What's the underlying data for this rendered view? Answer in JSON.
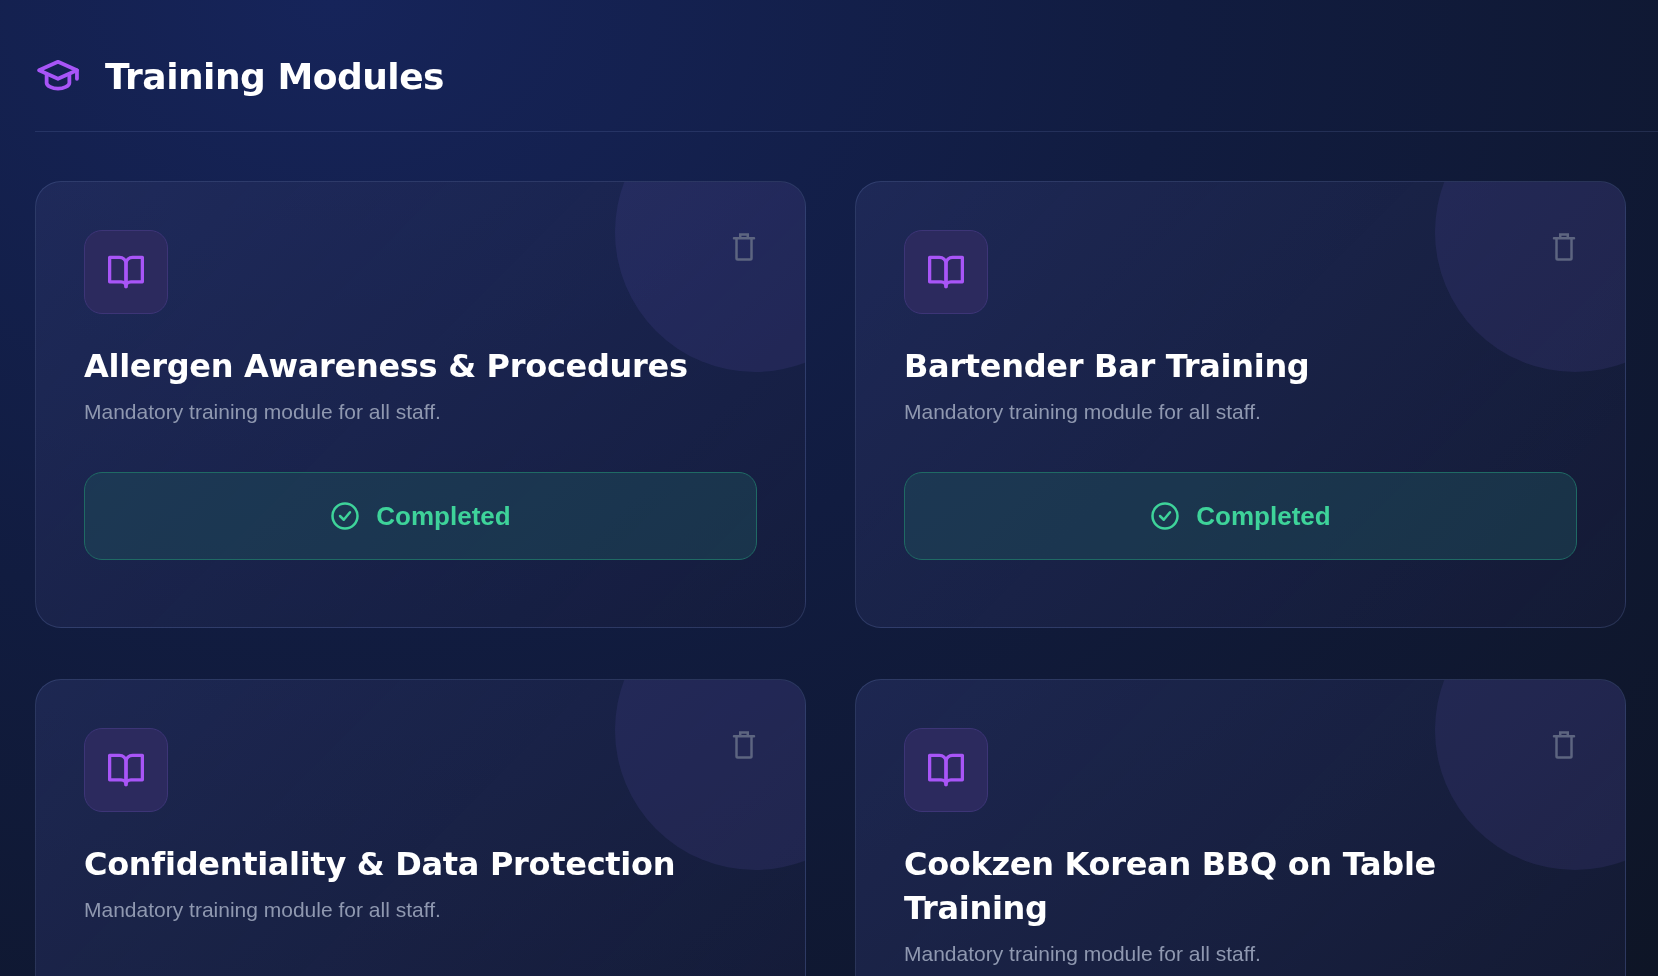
{
  "header": {
    "title": "Training Modules"
  },
  "modules": [
    {
      "title": "Allergen Awareness & Procedures",
      "description": "Mandatory training module for all staff.",
      "status": {
        "kind": "completed",
        "label": "Completed"
      }
    },
    {
      "title": "Bartender Bar Training",
      "description": "Mandatory training module for all staff.",
      "status": {
        "kind": "completed",
        "label": "Completed"
      }
    },
    {
      "title": "Confidentiality & Data Protection",
      "description": "Mandatory training module for all staff."
    },
    {
      "title": "Cookzen Korean BBQ on Table Training",
      "description": "Mandatory training module for all staff."
    }
  ]
}
